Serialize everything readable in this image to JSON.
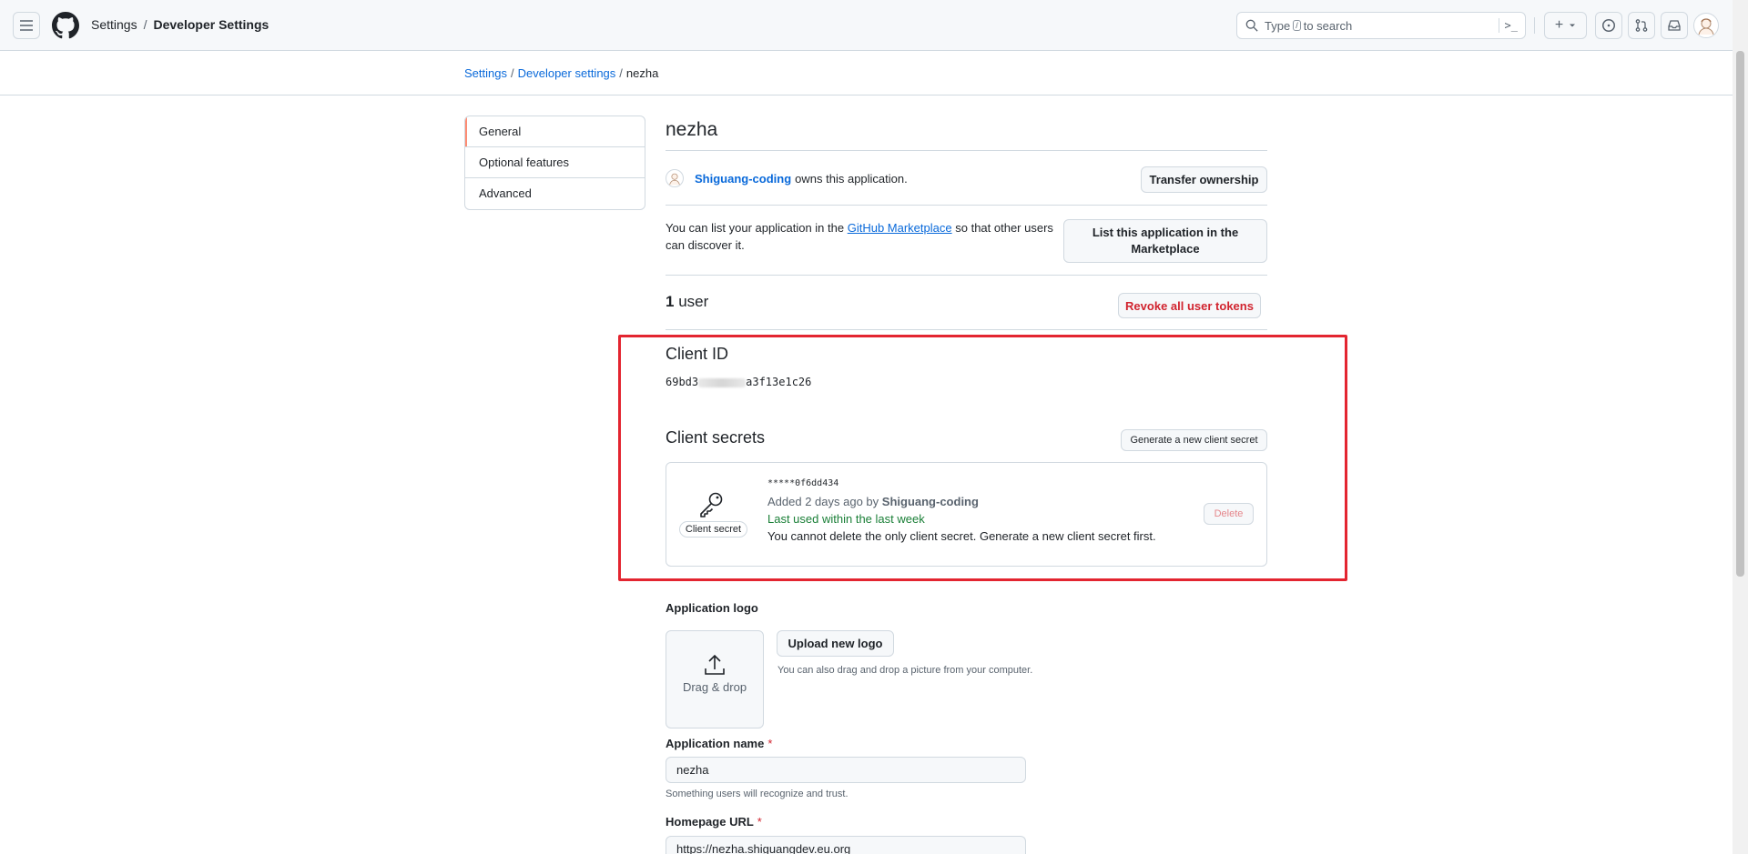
{
  "header": {
    "crumbs": [
      "Settings",
      "Developer Settings"
    ],
    "search_prefix": "Type",
    "search_key": "/",
    "search_suffix": "to search",
    "cmd_glyph": ">_"
  },
  "breadcrumb": {
    "items": [
      "Settings",
      "Developer settings"
    ],
    "current": "nezha"
  },
  "sidenav": {
    "items": [
      {
        "label": "General",
        "active": true
      },
      {
        "label": "Optional features",
        "active": false
      },
      {
        "label": "Advanced",
        "active": false
      }
    ]
  },
  "app": {
    "name": "nezha",
    "owner": "Shiguang-coding",
    "owns_text": "owns this application.",
    "transfer_button": "Transfer ownership",
    "marketplace_text_before": "You can list your application in the",
    "marketplace_link": "GitHub Marketplace",
    "marketplace_text_after": "so that other users can discover it.",
    "list_button": "List this application in the Marketplace",
    "users_count": "1",
    "users_label": "user",
    "revoke_button": "Revoke all user tokens"
  },
  "client": {
    "id_title": "Client ID",
    "id_prefix": "69bd3",
    "id_suffix": "a3f13e1c26",
    "secrets_title": "Client secrets",
    "generate_button": "Generate a new client secret",
    "secret": {
      "masked": "*****0f6dd434",
      "added": "Added 2 days ago by",
      "added_by": "Shiguang-coding",
      "last_used": "Last used within the last week",
      "note": "You cannot delete the only client secret. Generate a new client secret first.",
      "badge": "Client secret",
      "delete_button": "Delete"
    }
  },
  "logo": {
    "label": "Application logo",
    "drop_text": "Drag & drop",
    "upload_button": "Upload new logo",
    "hint": "You can also drag and drop a picture from your computer."
  },
  "form": {
    "name_label": "Application name",
    "required_mark": "*",
    "name_value": "nezha",
    "name_hint": "Something users will recognize and trust.",
    "homepage_label": "Homepage URL",
    "homepage_value": "https://nezha.shiguangdev.eu.org"
  },
  "colors": {
    "accent": "#0969da",
    "danger": "#d1242f",
    "success": "#1a7f37",
    "highlight_box": "#e32530",
    "nav_active": "#fd8c73"
  }
}
